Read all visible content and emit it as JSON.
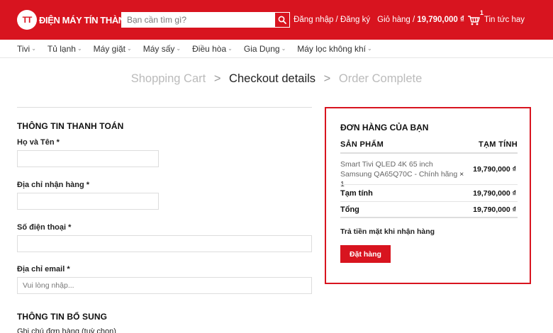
{
  "header": {
    "logo_badge": "TT",
    "logo_text": "ĐIỆN MÁY TÍN THÀNH",
    "search_placeholder": "Bạn cần tìm gì?",
    "login_label": "Đăng nhập / Đăng ký",
    "cart_label": "Giỏ hàng /",
    "cart_total": "19,790,000 ₫",
    "cart_count": "1",
    "news_label": "Tin tức hay",
    "brand_color": "#d8141f"
  },
  "nav": {
    "items": [
      {
        "label": "Tivi"
      },
      {
        "label": "Tủ lạnh"
      },
      {
        "label": "Máy giặt"
      },
      {
        "label": "Máy sấy"
      },
      {
        "label": "Điều hòa"
      },
      {
        "label": "Gia Dụng"
      },
      {
        "label": "Máy lọc không khí"
      }
    ]
  },
  "breadcrumb": {
    "step1": "Shopping Cart",
    "step2": "Checkout details",
    "step3": "Order Complete",
    "separator": ">"
  },
  "billing": {
    "title": "THÔNG TIN THANH TOÁN",
    "name_label": "Họ và Tên",
    "address_label": "Địa chỉ nhận hàng",
    "phone_label": "Số điện thoại",
    "email_label": "Địa chỉ email",
    "email_placeholder": "Vui lòng nhập...",
    "required_mark": "*"
  },
  "additional": {
    "title": "THÔNG TIN BỔ SUNG",
    "note_label": "Ghi chú đơn hàng (tuỳ chọn)"
  },
  "order": {
    "title": "ĐƠN HÀNG CỦA BẠN",
    "col_product": "SẢN PHẨM",
    "col_subtotal": "TẠM TÍNH",
    "product_name": "Smart Tivi QLED 4K 65 inch Samsung QA65Q70C - Chính hãng",
    "product_qty": "× 1",
    "product_price": "19,790,000 ₫",
    "subtotal_label": "Tạm tính",
    "subtotal_value": "19,790,000 ₫",
    "total_label": "Tổng",
    "total_value": "19,790,000 ₫",
    "payment_method": "Trả tiền mặt khi nhận hàng",
    "place_order_label": "Đặt hàng"
  }
}
